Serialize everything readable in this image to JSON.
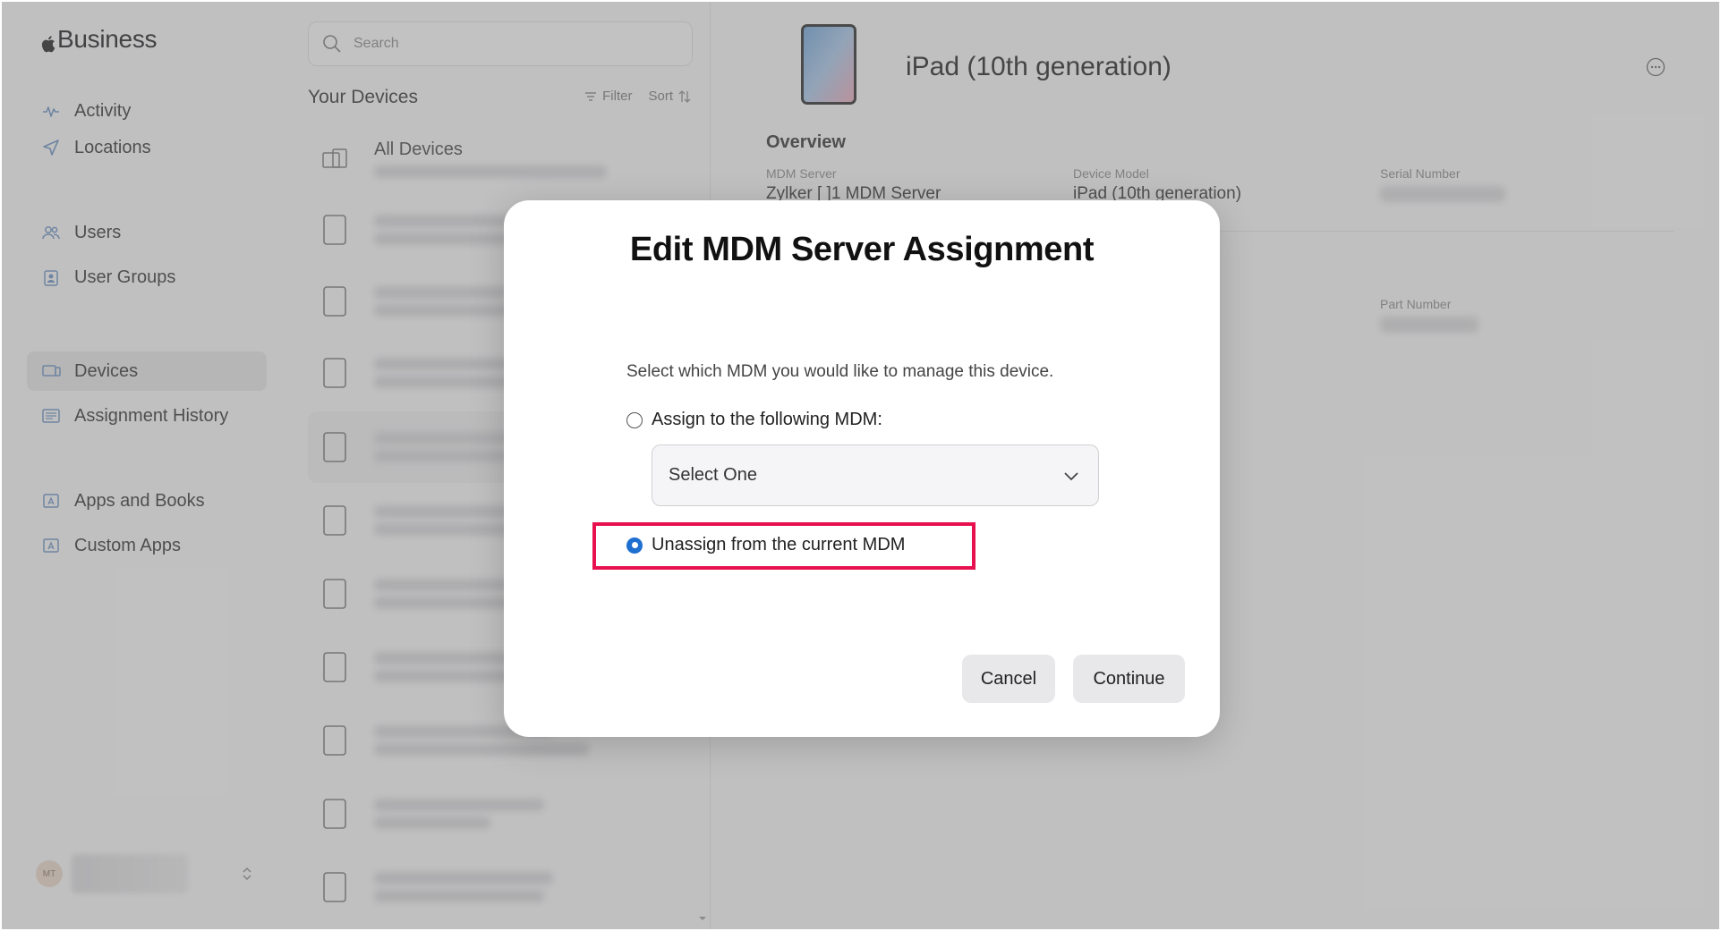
{
  "brand": {
    "name": "Business"
  },
  "sidebar": {
    "items": [
      {
        "label": "Activity",
        "icon": "activity-icon"
      },
      {
        "label": "Locations",
        "icon": "location-arrow-icon"
      },
      {
        "label": "Users",
        "icon": "users-icon"
      },
      {
        "label": "User Groups",
        "icon": "user-groups-icon"
      },
      {
        "label": "Devices",
        "icon": "devices-icon",
        "active": true
      },
      {
        "label": "Assignment History",
        "icon": "assignment-history-icon"
      },
      {
        "label": "Apps and Books",
        "icon": "apps-books-icon"
      },
      {
        "label": "Custom Apps",
        "icon": "custom-apps-icon"
      }
    ],
    "user": {
      "initials": "MT"
    }
  },
  "device_list": {
    "search_placeholder": "Search",
    "title": "Your Devices",
    "filter_label": "Filter",
    "sort_label": "Sort",
    "all_devices_label": "All Devices"
  },
  "detail": {
    "device_title": "iPad (10th generation)",
    "overview_title": "Overview",
    "fields": {
      "mdm_server_label": "MDM Server",
      "mdm_server_value": "Zylker [     ]1 MDM Server",
      "device_model_label": "Device Model",
      "device_model_value": "iPad (10th generation)",
      "serial_number_label": "Serial Number",
      "part_number_label": "Part Number"
    }
  },
  "modal": {
    "title": "Edit MDM Server Assignment",
    "description": "Select which MDM you would like to manage this device.",
    "option_assign": "Assign to the following MDM:",
    "select_value": "Select One",
    "option_unassign": "Unassign from the current MDM",
    "selected_option": "unassign",
    "cancel_label": "Cancel",
    "continue_label": "Continue",
    "highlight_color": "#e8114f",
    "accent_color": "#1f6fd1"
  }
}
